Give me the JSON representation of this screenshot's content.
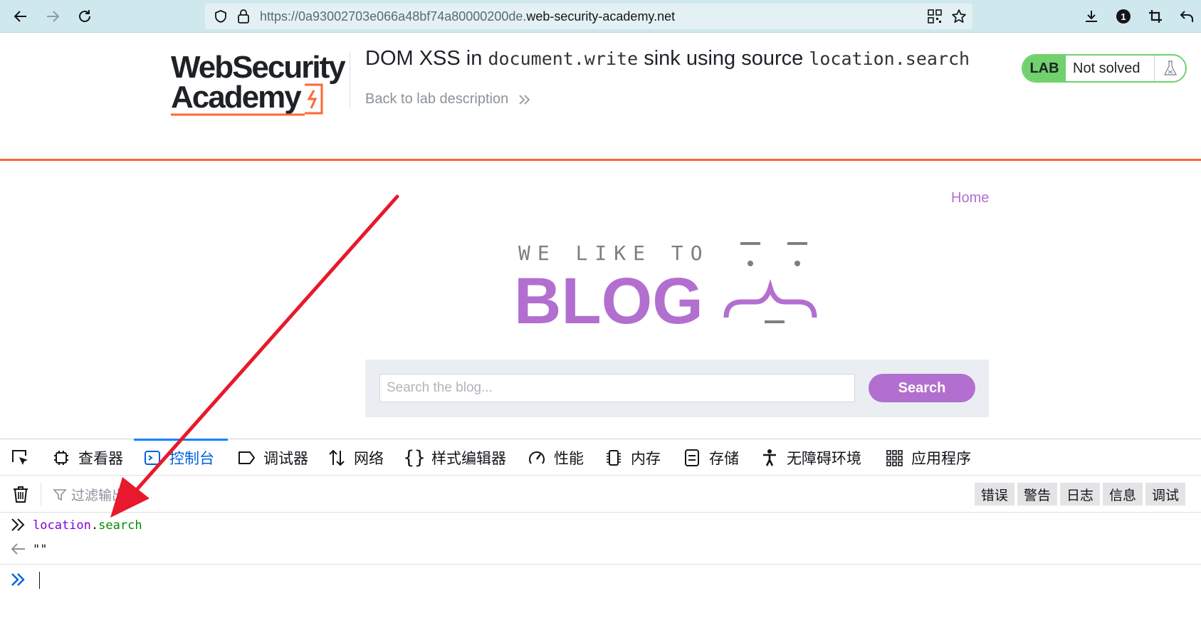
{
  "browser": {
    "url_prefix": "https://0a93002703e066a48bf74a80000200de.",
    "url_domain": "web-security-academy.net",
    "notification_count": "1"
  },
  "lab": {
    "logo_line1": "WebSecurity",
    "logo_line2": "Academy",
    "title_part1": "DOM XSS in ",
    "title_code1": "document.write",
    "title_part2": " sink using source ",
    "title_code2": "location.search",
    "back_link": "Back to lab description",
    "badge_label": "LAB",
    "badge_status": "Not solved"
  },
  "blog": {
    "home_link": "Home",
    "banner_top": "WE LIKE TO",
    "banner_bottom": "BLOG",
    "search_placeholder": "Search the blog...",
    "search_button": "Search"
  },
  "devtools": {
    "tabs": [
      {
        "label": "查看器",
        "icon": "inspector-icon"
      },
      {
        "label": "控制台",
        "icon": "console-icon"
      },
      {
        "label": "调试器",
        "icon": "debugger-icon"
      },
      {
        "label": "网络",
        "icon": "network-icon"
      },
      {
        "label": "样式编辑器",
        "icon": "style-editor-icon"
      },
      {
        "label": "性能",
        "icon": "performance-icon"
      },
      {
        "label": "内存",
        "icon": "memory-icon"
      },
      {
        "label": "存储",
        "icon": "storage-icon"
      },
      {
        "label": "无障碍环境",
        "icon": "accessibility-icon"
      },
      {
        "label": "应用程序",
        "icon": "application-icon"
      }
    ],
    "active_tab": "控制台",
    "filter_placeholder": "过滤输出",
    "levels": [
      "错误",
      "警告",
      "日志",
      "信息",
      "调试"
    ],
    "console": {
      "command_object": "location",
      "command_dot": ".",
      "command_prop": "search",
      "result": "\"\""
    }
  },
  "colors": {
    "accent_orange": "#ff6633",
    "blog_purple": "#b26fcf",
    "lab_green": "#70d16d",
    "devtools_blue": "#0a84ff",
    "annotation_red": "#e8192c"
  }
}
